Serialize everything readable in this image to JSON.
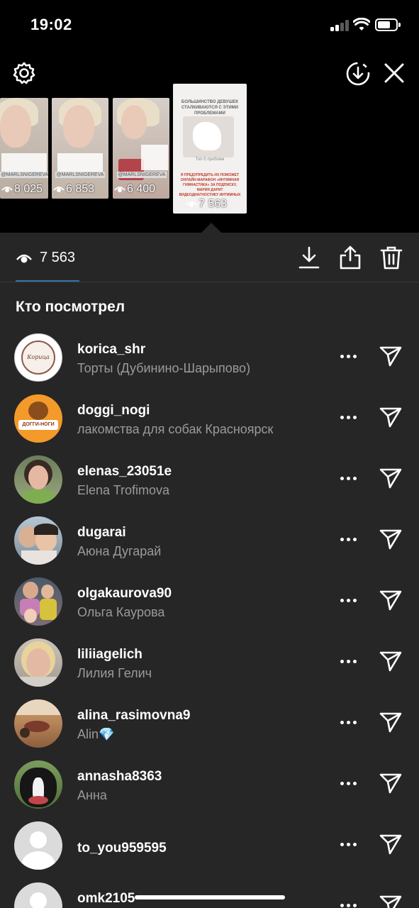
{
  "status_bar": {
    "time": "19:02"
  },
  "stories": [
    {
      "views": "8 025",
      "tag": "@MARLSNIGEREVA"
    },
    {
      "views": "6 853",
      "tag": "@MARLSNIGEREVA"
    },
    {
      "views": "6 400",
      "tag": "@MARLSNIGEREVA"
    },
    {
      "views": "7 563",
      "heading": "БОЛЬШИНСТВО ДЕВУШЕК СТАЛКИВАЮТСЯ С ЭТИМИ ПРОБЛЕМАМИ",
      "subtitle": "Топ-5 проблем",
      "promo": "Я ПРЕДУПРЕДИТЬ ИХ ПОМОЖЕТ ОНЛАЙН-МАРАФОН «ИНТИМНАЯ ГИМНАСТИКА» ЗА ПОДПИСКУ, МАРИЯ ДАРИТ ВИДЕОДИАГНОСТИКУ ИНТИМНЫХ"
    }
  ],
  "panel": {
    "view_count": "7 563",
    "section_title": "Кто посмотрел"
  },
  "viewers": [
    {
      "username": "korica_shr",
      "full_name": "Торты (Дубинино-Шарыпово)"
    },
    {
      "username": "doggi_nogi",
      "full_name": "лакомства для собак Красноярск"
    },
    {
      "username": "elenas_23051e",
      "full_name": "Elena Trofimova"
    },
    {
      "username": "dugarai",
      "full_name": "Аюна Дугарай"
    },
    {
      "username": "olgakaurova90",
      "full_name": "Ольга Каурова"
    },
    {
      "username": "liliiagelich",
      "full_name": "Лилия Гелич"
    },
    {
      "username": "alina_rasimovna9",
      "full_name": "Alin💎"
    },
    {
      "username": "annasha8363",
      "full_name": "Анна"
    },
    {
      "username": "to_you959595",
      "full_name": ""
    },
    {
      "username": "omk2105",
      "full_name": ""
    }
  ],
  "avatar_labels": {
    "korica": "Корица",
    "doggi": "ДОГГИ-НОГИ"
  },
  "colors": {
    "panel_bg": "#262626",
    "accent_tab": "#3a6fa8",
    "subtext": "#9a9a9a"
  }
}
